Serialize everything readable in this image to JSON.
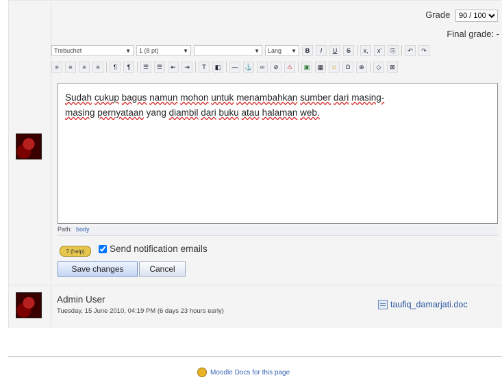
{
  "grade": {
    "label": "Grade",
    "value": "90 / 100",
    "final_label": "Final grade: -"
  },
  "toolbar": {
    "font_family": "Trebuchet",
    "font_size": "1 (8 pt)",
    "heading": "",
    "lang": "Lang",
    "row1_buttons": [
      "B",
      "I",
      "U",
      "S",
      "x,",
      "x'",
      "⎘",
      "↶",
      "↷"
    ],
    "row2_buttons": [
      "≡",
      "≡",
      "≡",
      "≡",
      "¶",
      "¶",
      "☰",
      "☰",
      "⇤",
      "⇥",
      "T",
      "◧",
      "—",
      "⚓",
      "∞",
      "⊘",
      "⚠",
      "▣",
      "▦",
      "☺",
      "Ω",
      "⊕",
      "◇",
      "⊠"
    ]
  },
  "editor": {
    "text_words": [
      "Sudah",
      "cukup",
      "bagus",
      "namun",
      "mohon",
      "untuk",
      "menambahkan",
      "sumber",
      "dari",
      "masing-masing",
      "pernyataan",
      "yang",
      "diambil",
      "dari",
      "buku",
      "atau",
      "halaman",
      "web."
    ],
    "line1": "Sudah cukup bagus namun mohon untuk menambahkan sumber dari masing-",
    "line2": "masing pernyataan yang diambil dari buku atau halaman web."
  },
  "path": {
    "label": "Path:",
    "value": "body"
  },
  "help_badge": "? (help)",
  "notify_label": "Send notification emails",
  "buttons": {
    "save": "Save changes",
    "cancel": "Cancel"
  },
  "admin": {
    "name": "Admin User",
    "date": "Tuesday, 15 June 2010, 04:19 PM (6 days 23 hours early)",
    "attachment": "taufiq_damarjati.doc"
  },
  "footer": {
    "docs_link": "Moodle Docs for this page"
  },
  "colors": {
    "accent_link": "#3a65b3",
    "misspell_underline": "#d33"
  }
}
